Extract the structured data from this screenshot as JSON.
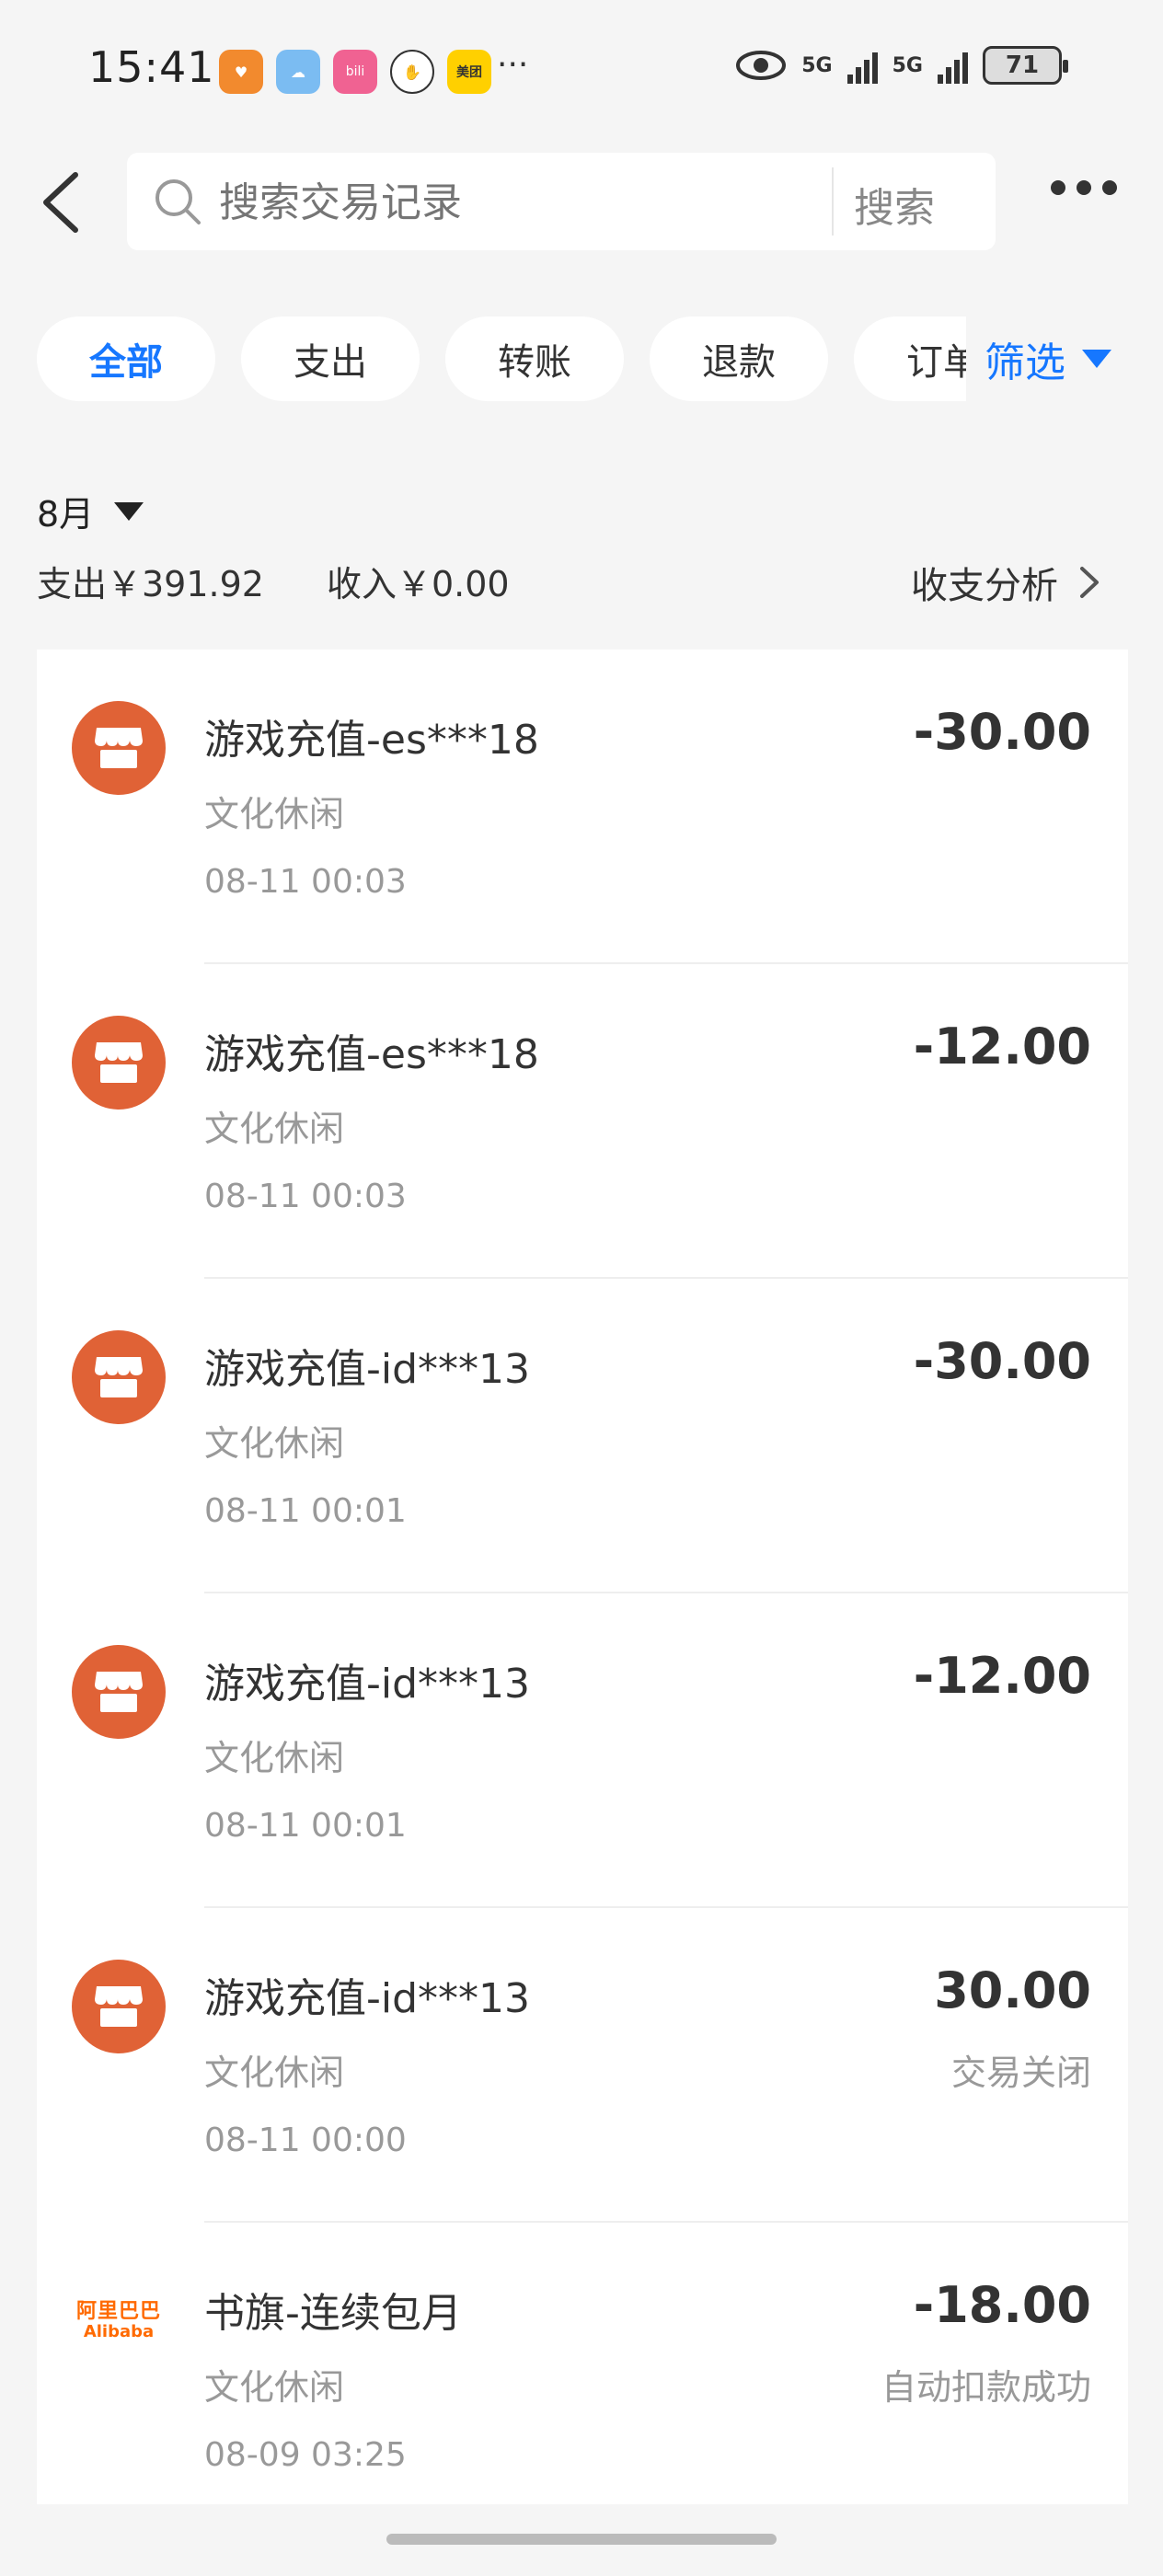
{
  "status_bar": {
    "time": "15:41",
    "apps": [
      {
        "name": "favorite-app-icon",
        "color": "#f28a2e",
        "glyph": "♥"
      },
      {
        "name": "weather-app-icon",
        "color": "#7bbcf2",
        "glyph": "☁"
      },
      {
        "name": "bilibili-app-icon",
        "color": "#f06292",
        "glyph": "bili"
      },
      {
        "name": "hand-app-icon",
        "color": "#ffffff",
        "glyph": "✋"
      },
      {
        "name": "meituan-app-icon",
        "color": "#ffd000",
        "glyph": "美团"
      }
    ],
    "overflow": "···",
    "sig1_label": "5G",
    "sig2_label": "5G",
    "battery": "71"
  },
  "header": {
    "search_placeholder": "搜索交易记录",
    "search_button": "搜索"
  },
  "filters": {
    "tabs": [
      "全部",
      "支出",
      "转账",
      "退款",
      "订单"
    ],
    "active_index": 0,
    "filter_label": "筛选"
  },
  "summary": {
    "month": "8月",
    "expense": "支出￥391.92",
    "income": "收入￥0.00",
    "analysis": "收支分析"
  },
  "transactions": [
    {
      "title": "游戏充值-es***18",
      "category": "文化休闲",
      "datetime": "08-11 00:03",
      "amount": "-30.00",
      "status": "",
      "icon": "shop-icon"
    },
    {
      "title": "游戏充值-es***18",
      "category": "文化休闲",
      "datetime": "08-11 00:03",
      "amount": "-12.00",
      "status": "",
      "icon": "shop-icon"
    },
    {
      "title": "游戏充值-id***13",
      "category": "文化休闲",
      "datetime": "08-11 00:01",
      "amount": "-30.00",
      "status": "",
      "icon": "shop-icon"
    },
    {
      "title": "游戏充值-id***13",
      "category": "文化休闲",
      "datetime": "08-11 00:01",
      "amount": "-12.00",
      "status": "",
      "icon": "shop-icon"
    },
    {
      "title": "游戏充值-id***13",
      "category": "文化休闲",
      "datetime": "08-11 00:00",
      "amount": "30.00",
      "status": "交易关闭",
      "icon": "shop-icon"
    },
    {
      "title": "书旗-连续包月",
      "category": "文化休闲",
      "datetime": "08-09 03:25",
      "amount": "-18.00",
      "status": "自动扣款成功",
      "icon": "alibaba-logo-icon",
      "logo_cn": "阿里巴巴",
      "logo_en": "Alibaba"
    }
  ],
  "colors": {
    "accent": "#1677ff",
    "shop_icon_bg": "#e06236",
    "alibaba_orange": "#ff6a00"
  }
}
